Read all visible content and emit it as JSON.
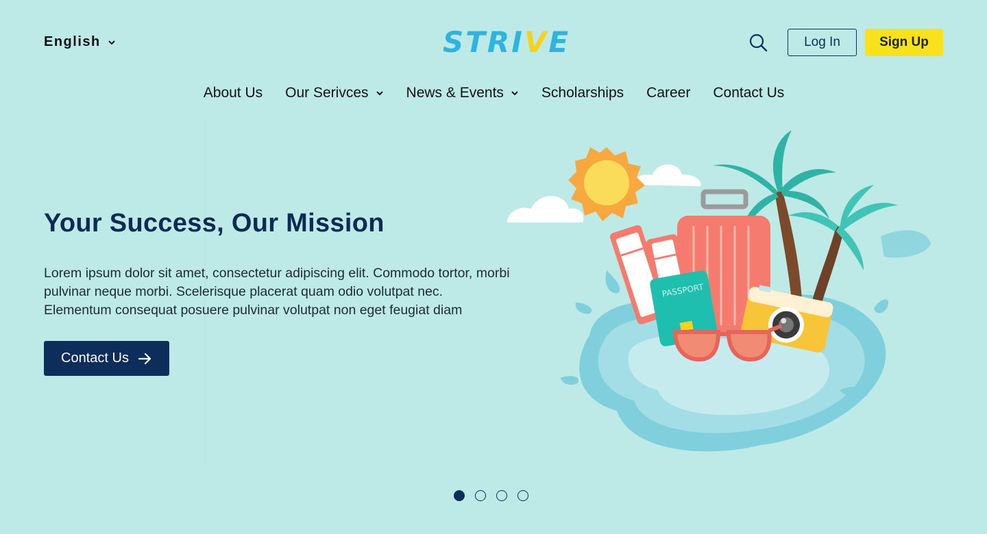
{
  "header": {
    "language": "English",
    "logo_text": "STRIVE",
    "logo_prefix": "STRI",
    "logo_accent": "V",
    "logo_suffix": "E",
    "login_label": "Log In",
    "signup_label": "Sign Up"
  },
  "nav": {
    "items": [
      {
        "label": "About Us"
      },
      {
        "label": "Our Serivces"
      },
      {
        "label": "News & Events"
      },
      {
        "label": "Scholarships"
      },
      {
        "label": "Career"
      },
      {
        "label": "Contact Us"
      }
    ]
  },
  "hero": {
    "title": "Your Success, Our Mission",
    "body": "Lorem ipsum dolor sit amet, consectetur adipiscing elit. Commodo tortor, morbi pulvinar neque morbi. Scelerisque placerat quam odio volutpat nec. Elementum consequat posuere pulvinar volutpat non eget feugiat diam",
    "cta_label": "Contact Us",
    "illustration_passport_text": "PASSPORT"
  },
  "carousel": {
    "slide_count": 4,
    "active_index": 0
  },
  "icons": {
    "search": "search-icon",
    "chevron": "chevron-down-icon",
    "arrow": "arrow-right-icon"
  },
  "colors": {
    "background": "#bde9e7",
    "navy": "#0d2d5a",
    "yellow": "#f9e21b",
    "logo_blue": "#2fb4e0",
    "logo_accent": "#f7d21d"
  }
}
